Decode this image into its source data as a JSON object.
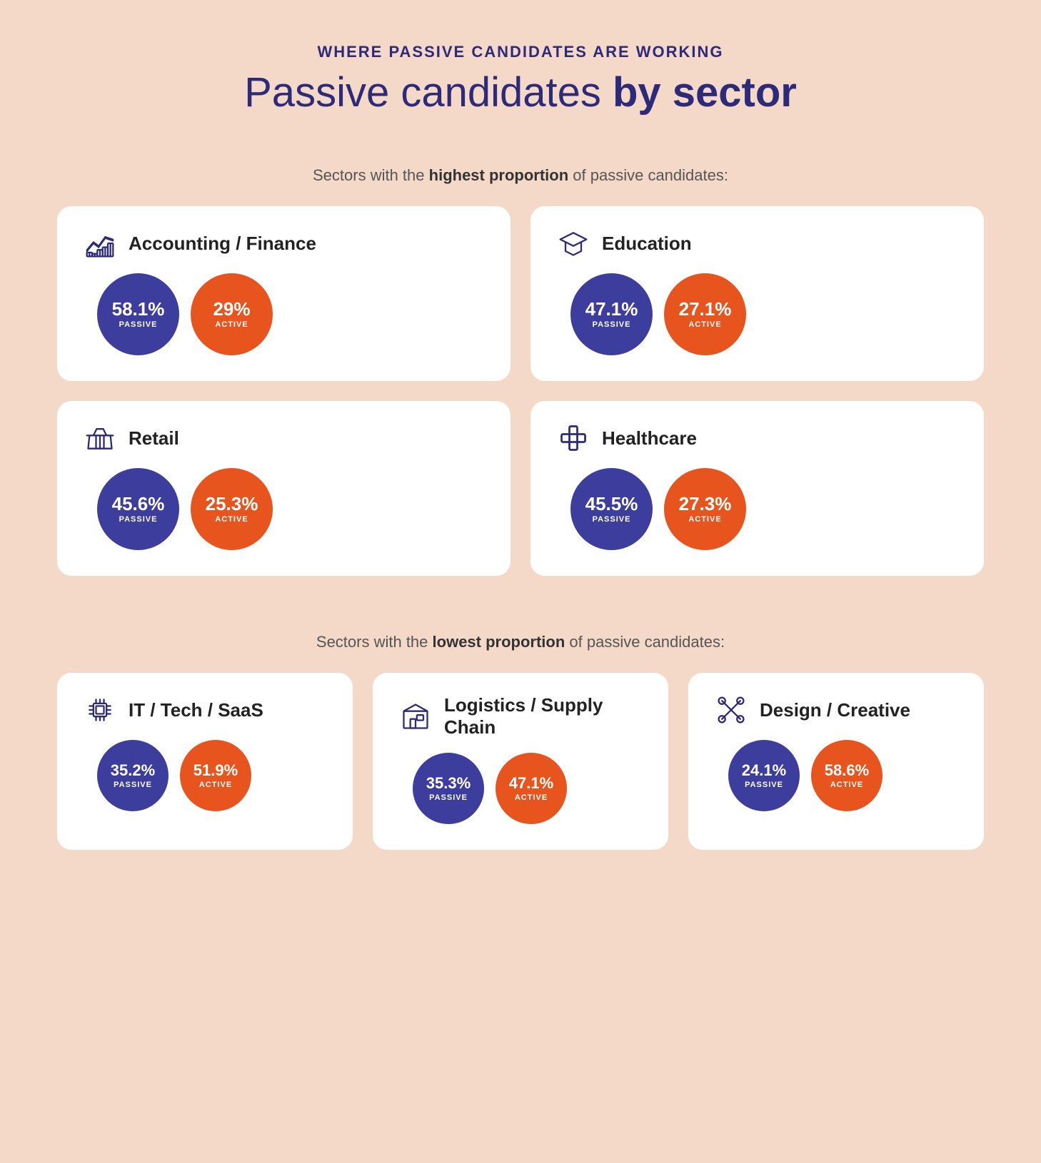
{
  "header": {
    "subtitle": "WHERE PASSIVE CANDIDATES ARE WORKING",
    "title_plain": "Passive candidates ",
    "title_bold": "by sector"
  },
  "sections": {
    "highest": {
      "intro_plain": "Sectors with the ",
      "intro_bold": "highest proportion",
      "intro_end": " of passive candidates:",
      "cards": [
        {
          "id": "accounting-finance",
          "icon": "chart-line",
          "title": "Accounting / Finance",
          "passive_pct": "58.1%",
          "passive_label": "PASSIVE",
          "active_pct": "29%",
          "active_label": "ACTIVE"
        },
        {
          "id": "education",
          "icon": "graduation-cap",
          "title": "Education",
          "passive_pct": "47.1%",
          "passive_label": "PASSIVE",
          "active_pct": "27.1%",
          "active_label": "ACTIVE"
        },
        {
          "id": "retail",
          "icon": "basket",
          "title": "Retail",
          "passive_pct": "45.6%",
          "passive_label": "PASSIVE",
          "active_pct": "25.3%",
          "active_label": "ACTIVE"
        },
        {
          "id": "healthcare",
          "icon": "cross",
          "title": "Healthcare",
          "passive_pct": "45.5%",
          "passive_label": "PASSIVE",
          "active_pct": "27.3%",
          "active_label": "ACTIVE"
        }
      ]
    },
    "lowest": {
      "intro_plain": "Sectors with the ",
      "intro_bold": "lowest proportion",
      "intro_end": " of passive candidates:",
      "cards": [
        {
          "id": "it-tech-saas",
          "icon": "chip",
          "title": "IT / Tech / SaaS",
          "passive_pct": "35.2%",
          "passive_label": "PASSIVE",
          "active_pct": "51.9%",
          "active_label": "ACTIVE"
        },
        {
          "id": "logistics-supply-chain",
          "icon": "warehouse",
          "title": "Logistics / Supply Chain",
          "passive_pct": "35.3%",
          "passive_label": "PASSIVE",
          "active_pct": "47.1%",
          "active_label": "ACTIVE"
        },
        {
          "id": "design-creative",
          "icon": "scissors",
          "title": "Design / Creative",
          "passive_pct": "24.1%",
          "passive_label": "PASSIVE",
          "active_pct": "58.6%",
          "active_label": "ACTIVE"
        }
      ]
    }
  }
}
